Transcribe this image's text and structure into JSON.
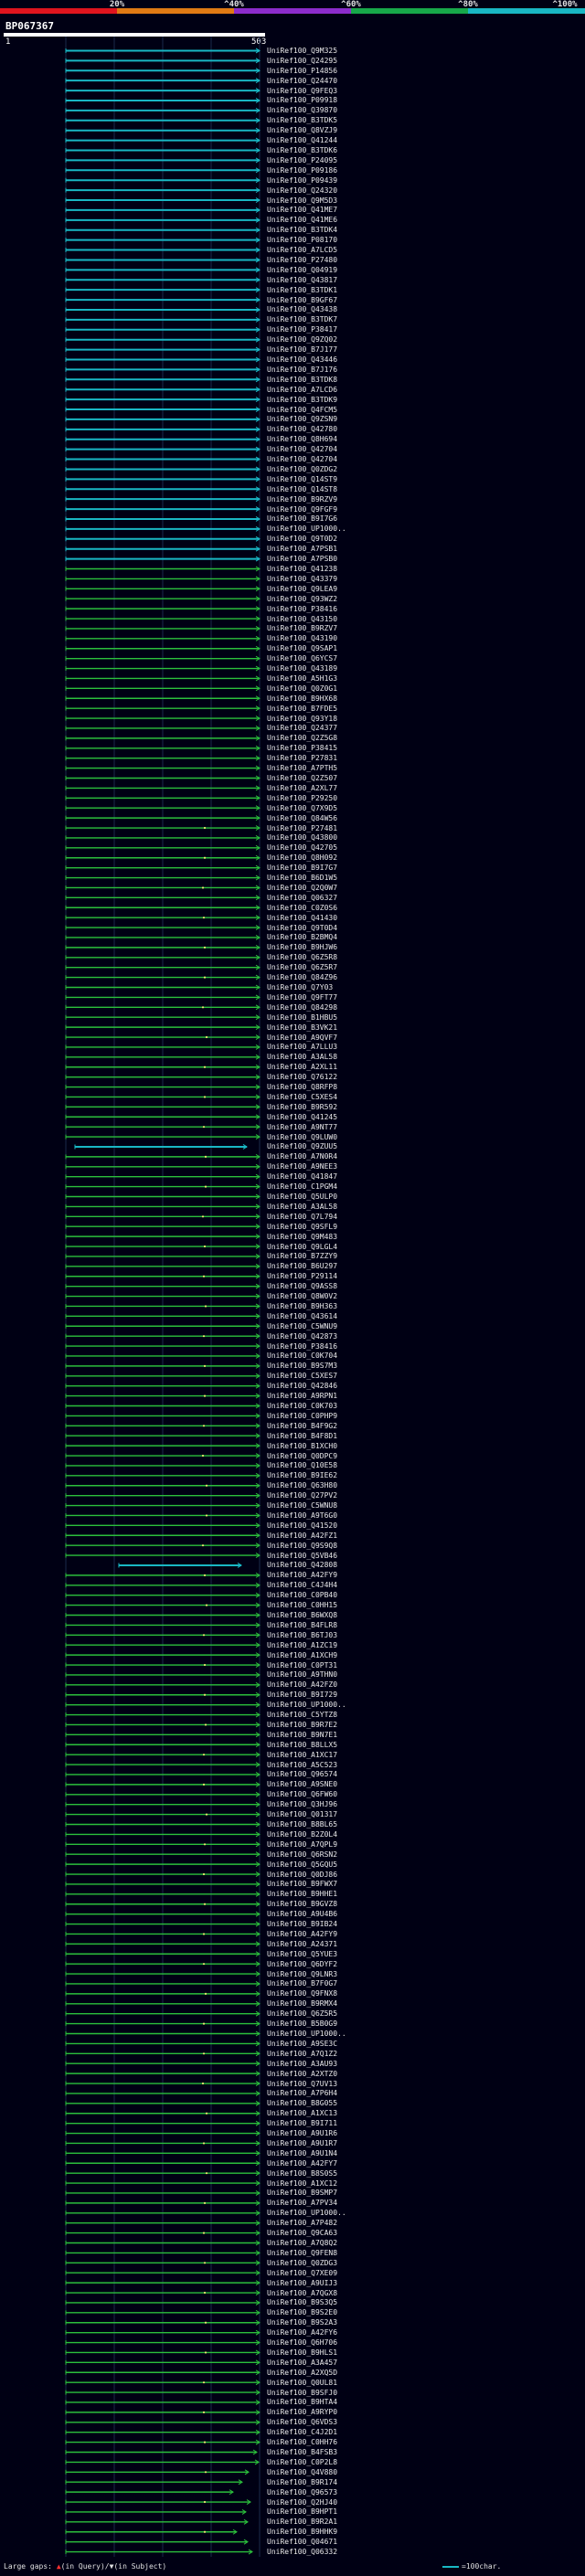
{
  "scale": {
    "ticks": [
      "20%",
      "^40%",
      "^60%",
      "^80%",
      "^100%"
    ],
    "segments": [
      {
        "color": "#e0141e",
        "from": 0,
        "to": 20
      },
      {
        "color": "#e07a14",
        "from": 20,
        "to": 40
      },
      {
        "color": "#8c2ccc",
        "from": 40,
        "to": 60
      },
      {
        "color": "#17a84a",
        "from": 60,
        "to": 80
      },
      {
        "color": "#19b7c4",
        "from": 80,
        "to": 100
      }
    ]
  },
  "query": {
    "id": "BP067367",
    "start": "1",
    "end": "503"
  },
  "colors": {
    "cyan": "#19b7c4",
    "green": "#2bbf3c",
    "purple": "#9b30b0",
    "background": "#000014"
  },
  "hits": [
    "UniRef100_Q9M325",
    "UniRef100_Q24295",
    "UniRef100_P14856",
    "UniRef100_Q24470",
    "UniRef100_Q9FEQ3",
    "UniRef100_P09918",
    "UniRef100_Q39870",
    "UniRef100_B3TDK5",
    "UniRef100_Q8VZJ9",
    "UniRef100_Q41244",
    "UniRef100_B3TDK6",
    "UniRef100_P24095",
    "UniRef100_P09186",
    "UniRef100_P09439",
    "UniRef100_Q24320",
    "UniRef100_Q9M5D3",
    "UniRef100_Q41ME7",
    "UniRef100_Q41ME6",
    "UniRef100_B3TDK4",
    "UniRef100_P08170",
    "UniRef100_A7LCD5",
    "UniRef100_P27480",
    "UniRef100_Q04919",
    "UniRef100_Q43817",
    "UniRef100_B3TDK1",
    "UniRef100_B9GF67",
    "UniRef100_Q43438",
    "UniRef100_B3TDK7",
    "UniRef100_P38417",
    "UniRef100_Q9ZQ02",
    "UniRef100_B7J177",
    "UniRef100_Q43446",
    "UniRef100_B7J176",
    "UniRef100_B3TDK8",
    "UniRef100_A7LCD6",
    "UniRef100_B3TDK9",
    "UniRef100_Q4FCM5",
    "UniRef100_Q9ZSN9",
    "UniRef100_Q42780",
    "UniRef100_Q8H694",
    "UniRef100_Q42704",
    "UniRef100_Q42704",
    "UniRef100_Q0ZDG2",
    "UniRef100_Q14ST9",
    "UniRef100_Q14ST8",
    "UniRef100_B9RZV9",
    "UniRef100_Q9FGF9",
    "UniRef100_B9I7G6",
    "UniRef100_UP1000..",
    "UniRef100_Q9T0D2",
    "UniRef100_A7PSB1",
    "UniRef100_A7PSB0",
    "UniRef100_Q41238",
    "UniRef100_Q43379",
    "UniRef100_Q9LEA9",
    "UniRef100_Q93WZ2",
    "UniRef100_P38416",
    "UniRef100_Q43150",
    "UniRef100_B9RZV7",
    "UniRef100_Q43190",
    "UniRef100_Q9SAP1",
    "UniRef100_Q6YCS7",
    "UniRef100_Q43189",
    "UniRef100_A5H1G3",
    "UniRef100_Q0Z0G1",
    "UniRef100_B9HX68",
    "UniRef100_B7FDE5",
    "UniRef100_Q93Y18",
    "UniRef100_Q24377",
    "UniRef100_Q2Z5G8",
    "UniRef100_P38415",
    "UniRef100_P27831",
    "UniRef100_A7PTH5",
    "UniRef100_Q2Z507",
    "UniRef100_A2XL77",
    "UniRef100_P29250",
    "UniRef100_Q7X9D5",
    "UniRef100_Q84W56",
    "UniRef100_P27481",
    "UniRef100_Q43800",
    "UniRef100_Q42705",
    "UniRef100_Q8H092",
    "UniRef100_B9I7G7",
    "UniRef100_B6D1W5",
    "UniRef100_Q2Q0W7",
    "UniRef100_Q06327",
    "UniRef100_C0Z0S6",
    "UniRef100_Q41430",
    "UniRef100_Q9T0D4",
    "UniRef100_B2BMQ4",
    "UniRef100_B9HJW6",
    "UniRef100_Q6Z5R8",
    "UniRef100_Q6Z5R7",
    "UniRef100_Q84Z96",
    "UniRef100_Q7Y03",
    "UniRef100_Q9FT77",
    "UniRef100_Q84298",
    "UniRef100_B1HBU5",
    "UniRef100_B3VK21",
    "UniRef100_A9QVF7",
    "UniRef100_A7LLU3",
    "UniRef100_A3AL58",
    "UniRef100_A2XL11",
    "UniRef100_Q76122",
    "UniRef100_Q8RFP8",
    "UniRef100_C5XES4",
    "UniRef100_B9R592",
    "UniRef100_Q41245",
    "UniRef100_A9NT77",
    "UniRef100_Q9LUW0",
    "UniRef100_Q9ZUU5",
    "UniRef100_A7N0R4",
    "UniRef100_A9NEE3",
    "UniRef100_Q41847",
    "UniRef100_C1PGM4",
    "UniRef100_Q5ULP0",
    "UniRef100_A3AL58",
    "UniRef100_Q7L794",
    "UniRef100_Q9SFL9",
    "UniRef100_Q9M483",
    "UniRef100_Q9LGL4",
    "UniRef100_B7ZZY9",
    "UniRef100_B6U297",
    "UniRef100_P29114",
    "UniRef100_Q9ASS8",
    "UniRef100_Q8W0V2",
    "UniRef100_B9H363",
    "UniRef100_Q43614",
    "UniRef100_C5WNU9",
    "UniRef100_Q42873",
    "UniRef100_P38416",
    "UniRef100_C0K704",
    "UniRef100_B9S7M3",
    "UniRef100_C5XES7",
    "UniRef100_Q42846",
    "UniRef100_A9RPN1",
    "UniRef100_C0K703",
    "UniRef100_C0PHP9",
    "UniRef100_B4F9G2",
    "UniRef100_B4F8D1",
    "UniRef100_B1XCH0",
    "UniRef100_Q0DPC9",
    "UniRef100_Q10E58",
    "UniRef100_B9IE62",
    "UniRef100_Q63H80",
    "UniRef100_Q27PV2",
    "UniRef100_C5WNU8",
    "UniRef100_A9T6G0",
    "UniRef100_Q41520",
    "UniRef100_A42FZ1",
    "UniRef100_Q9S9Q8",
    "UniRef100_Q5VB46",
    "UniRef100_Q42808",
    "UniRef100_A42FY9",
    "UniRef100_C4J4H4",
    "UniRef100_C0PB40",
    "UniRef100_C0HH15",
    "UniRef100_B6WXQ8",
    "UniRef100_B4FLR8",
    "UniRef100_B6TJ03",
    "UniRef100_A1ZC19",
    "UniRef100_A1XCH9",
    "UniRef100_C0PT31",
    "UniRef100_A9THN0",
    "UniRef100_A42FZ0",
    "UniRef100_B9I729",
    "UniRef100_UP1000..",
    "UniRef100_C5YTZ8",
    "UniRef100_B9R7E2",
    "UniRef100_B9N7E1",
    "UniRef100_B8LLX5",
    "UniRef100_A1XC17",
    "UniRef100_A5C523",
    "UniRef100_Q96574",
    "UniRef100_A9SNE0",
    "UniRef100_Q6FW60",
    "UniRef100_Q3HJ96",
    "UniRef100_Q01317",
    "UniRef100_B8BL65",
    "UniRef100_B2Z0L4",
    "UniRef100_A7QPL9",
    "UniRef100_Q6RSN2",
    "UniRef100_Q5GQU5",
    "UniRef100_Q0DJ86",
    "UniRef100_B9FWX7",
    "UniRef100_B9HHE1",
    "UniRef100_B9GVZ8",
    "UniRef100_A9U4B6",
    "UniRef100_B9IB24",
    "UniRef100_A42FY9",
    "UniRef100_A24371",
    "UniRef100_Q5YUE3",
    "UniRef100_Q6DYF2",
    "UniRef100_Q9LNR3",
    "UniRef100_B7F0G7",
    "UniRef100_Q9FNX8",
    "UniRef100_B9RMX4",
    "UniRef100_Q6Z5R5",
    "UniRef100_B5B0G9",
    "UniRef100_UP1000..",
    "UniRef100_A9SE3C",
    "UniRef100_A7Q1Z2",
    "UniRef100_A3AU93",
    "UniRef100_A2XTZ0",
    "UniRef100_Q7UV13",
    "UniRef100_A7P6H4",
    "UniRef100_B8G055",
    "UniRef100_A1XC13",
    "UniRef100_B9I711",
    "UniRef100_A9U1R6",
    "UniRef100_A9U1R7",
    "UniRef100_A9U1N4",
    "UniRef100_A42FY7",
    "UniRef100_B8S0S5",
    "UniRef100_A1XC12",
    "UniRef100_B9SMP7",
    "UniRef100_A7PV34",
    "UniRef100_UP1000..",
    "UniRef100_A7P482",
    "UniRef100_Q9CA63",
    "UniRef100_A7Q8Q2",
    "UniRef100_Q9FEN8",
    "UniRef100_Q0ZDG3",
    "UniRef100_Q7XE09",
    "UniRef100_A9UIJ3",
    "UniRef100_A7QGX8",
    "UniRef100_B9S3Q5",
    "UniRef100_B9S2E0",
    "UniRef100_B9S2A3",
    "UniRef100_A42FY6",
    "UniRef100_Q6H706",
    "UniRef100_B9HLS1",
    "UniRef100_A3A457",
    "UniRef100_A2XQ5D",
    "UniRef100_Q0UL81",
    "UniRef100_B9SFJ0",
    "UniRef100_B9HTA4",
    "UniRef100_A9RYP0",
    "UniRef100_Q6VDS3",
    "UniRef100_C4J2D1",
    "UniRef100_C0HH76",
    "UniRef100_B4FSB3",
    "UniRef100_C0P2L8",
    "UniRef100_Q4V880",
    "UniRef100_B9R174",
    "UniRef100_Q96573",
    "UniRef100_Q2HJ40",
    "UniRef100_B9HPT1",
    "UniRef100_B9R2A1",
    "UniRef100_B9HHK9",
    "UniRef100_Q04671",
    "UniRef100_Q06332"
  ],
  "footer": {
    "gaps_label": "Large gaps:",
    "in_query_label": "(in Query)/",
    "in_subject_label": "(in Subject)",
    "scale_label": "=100char."
  }
}
